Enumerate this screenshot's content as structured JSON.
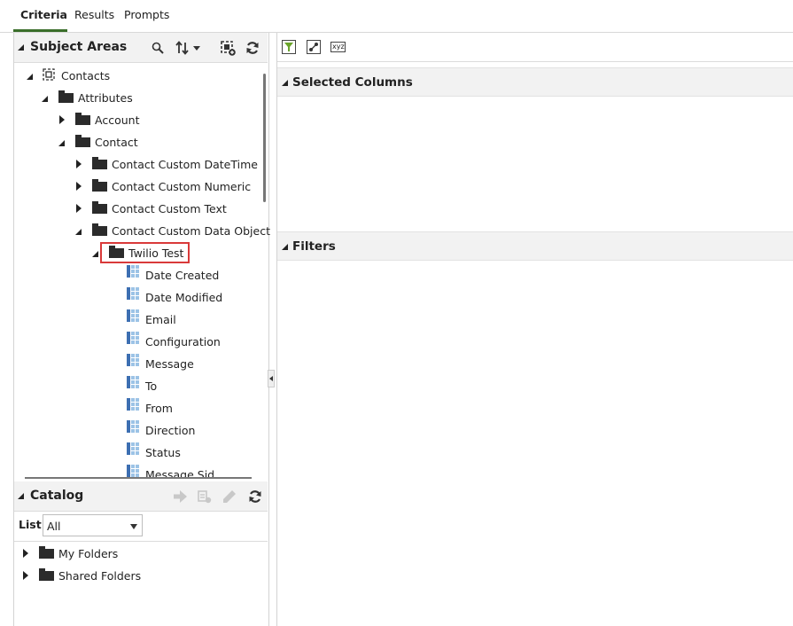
{
  "tabs": [
    {
      "label": "Criteria",
      "active": true
    },
    {
      "label": "Results",
      "active": false
    },
    {
      "label": "Prompts",
      "active": false
    }
  ],
  "subject_areas": {
    "title": "Subject Areas",
    "toolbar_icons": [
      "search-icon",
      "sort-icon",
      "add-subject-area-icon",
      "refresh-icon"
    ]
  },
  "tree": [
    {
      "label": "Contacts",
      "type": "subject-area",
      "state": "expanded"
    },
    {
      "label": "Attributes",
      "type": "folder",
      "state": "expanded"
    },
    {
      "label": "Account",
      "type": "folder",
      "state": "collapsed"
    },
    {
      "label": "Contact",
      "type": "folder",
      "state": "expanded"
    },
    {
      "label": "Contact Custom DateTime",
      "type": "folder",
      "state": "collapsed"
    },
    {
      "label": "Contact Custom Numeric",
      "type": "folder",
      "state": "collapsed"
    },
    {
      "label": "Contact Custom Text",
      "type": "folder",
      "state": "collapsed"
    },
    {
      "label": "Contact Custom Data Object",
      "type": "folder",
      "state": "expanded"
    },
    {
      "label": "Twilio Test",
      "type": "folder",
      "state": "expanded",
      "highlighted": true
    },
    {
      "label": "Date Created",
      "type": "column"
    },
    {
      "label": "Date Modified",
      "type": "column"
    },
    {
      "label": "Email",
      "type": "column"
    },
    {
      "label": "Configuration",
      "type": "column"
    },
    {
      "label": "Message",
      "type": "column"
    },
    {
      "label": "To",
      "type": "column"
    },
    {
      "label": "From",
      "type": "column"
    },
    {
      "label": "Direction",
      "type": "column"
    },
    {
      "label": "Status",
      "type": "column"
    },
    {
      "label": "Message Sid",
      "type": "column"
    }
  ],
  "catalog": {
    "title": "Catalog",
    "list_label": "List",
    "list_value": "All",
    "folders": [
      "My Folders",
      "Shared Folders"
    ]
  },
  "right": {
    "toolbar_icons": [
      "filter-icon",
      "edit-formula-icon",
      "xyz-icon"
    ],
    "xyz_label": "xyz",
    "selected_columns_title": "Selected Columns",
    "filters_title": "Filters"
  },
  "colors": {
    "accent": "#3a6e2a",
    "highlight": "#d93a3a",
    "header_bg": "#f2f2f2"
  }
}
